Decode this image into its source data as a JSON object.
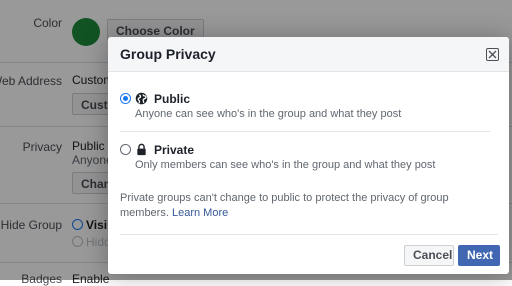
{
  "background": {
    "color_label": "Color",
    "choose_color_button": "Choose Color",
    "web_address_label": "Web Address",
    "web_address_value": "Custom",
    "web_address_button": "Custo",
    "privacy_label": "Privacy",
    "privacy_value": "Public g",
    "privacy_desc": "Anyone",
    "privacy_button": "Chang",
    "hide_group_label": "Hide Group",
    "hide_visible": "Visib",
    "hide_hidden": "Hidd",
    "badges_label": "Badges",
    "badges_value": "Enable",
    "swatch_color": "#1d8a3a"
  },
  "modal": {
    "title": "Group Privacy",
    "options": [
      {
        "label": "Public",
        "description": "Anyone can see who's in the group and what they post",
        "icon": "globe-icon",
        "selected": true
      },
      {
        "label": "Private",
        "description": "Only members can see who's in the group and what they post",
        "icon": "lock-icon",
        "selected": false
      }
    ],
    "note": "Private groups can't change to public to protect the privacy of group members.",
    "learn_more": "Learn More",
    "cancel_label": "Cancel",
    "next_label": "Next"
  },
  "colors": {
    "accent": "#4267b2",
    "radio_selected": "#1877f2",
    "link": "#365899"
  }
}
